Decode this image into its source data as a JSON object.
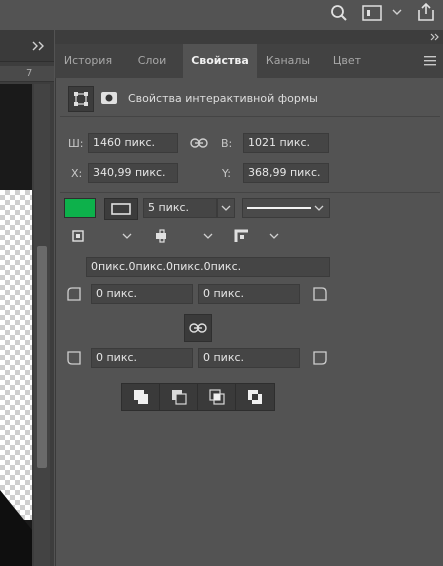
{
  "tabs": [
    {
      "label": "История",
      "active": false
    },
    {
      "label": "Слои",
      "active": false
    },
    {
      "label": "Свойства",
      "active": true
    },
    {
      "label": "Каналы",
      "active": false
    },
    {
      "label": "Цвет",
      "active": false
    }
  ],
  "ruler": {
    "mark": "7"
  },
  "section": {
    "title": "Свойства интерактивной формы"
  },
  "dimensions": {
    "w_label": "Ш:",
    "w_value": "1460 пикс.",
    "h_label": "В:",
    "h_value": "1021 пикс.",
    "x_label": "X:",
    "x_value": "340,99 пикс.",
    "y_label": "Y:",
    "y_value": "368,99 пикс."
  },
  "stroke": {
    "fill_color": "#0db14b",
    "width_value": "5 пикс."
  },
  "corners": {
    "all_radii": "0пикс.0пикс.0пикс.0пикс.",
    "top_left": "0 пикс.",
    "top_right": "0 пикс.",
    "bottom_left": "0 пикс.",
    "bottom_right": "0 пикс."
  },
  "colors": {
    "panel": "#535353",
    "tab_bar": "#424242",
    "field": "#454545",
    "accent_fill": "#0db14b"
  }
}
